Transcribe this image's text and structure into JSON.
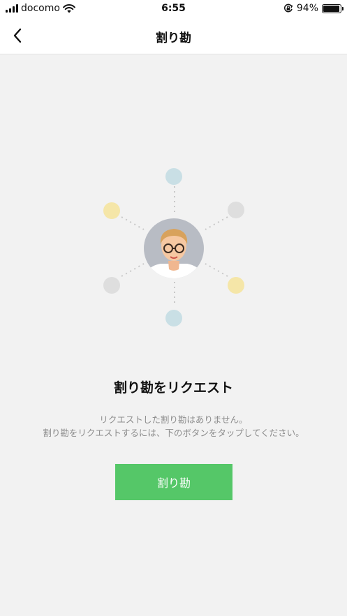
{
  "status_bar": {
    "carrier": "docomo",
    "time": "6:55",
    "battery_percent_label": "94%",
    "battery_level": 0.94,
    "icons": [
      "signal-bars-icon",
      "wifi-icon",
      "orientation-lock-icon",
      "battery-icon"
    ]
  },
  "nav": {
    "title": "割り勘",
    "back_icon": "chevron-left-icon"
  },
  "illustration": {
    "avatar": "person-with-glasses-avatar",
    "node_colors": {
      "blue": "#c9dfe5",
      "yellow": "#f5e6a8",
      "gray": "#dedede"
    },
    "avatar_bg": "#b8bcc4"
  },
  "main": {
    "title": "割り勘をリクエスト",
    "description_line1": "リクエストした割り勘はありません。",
    "description_line2": "割り勘をリクエストするには、下のボタンをタップしてください。"
  },
  "button": {
    "label": "割り勘",
    "color": "#55c768"
  }
}
